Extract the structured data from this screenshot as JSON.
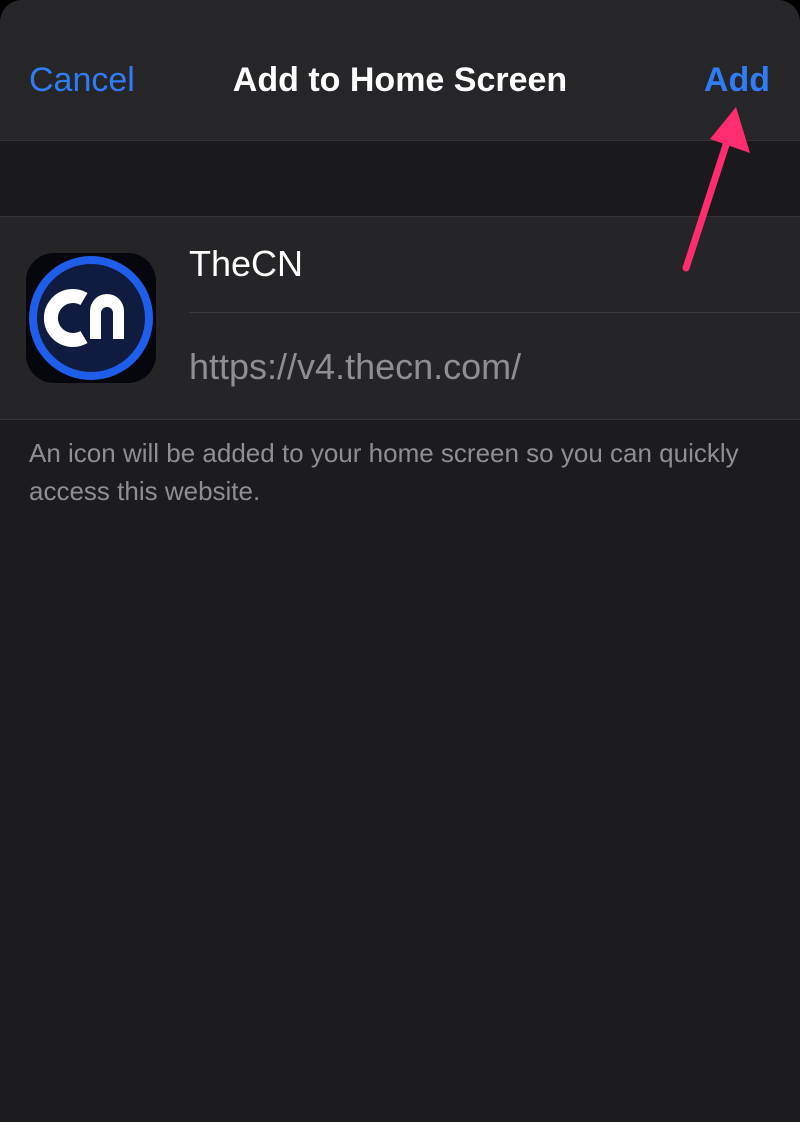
{
  "nav": {
    "cancel_label": "Cancel",
    "title": "Add to Home Screen",
    "add_label": "Add"
  },
  "app": {
    "name": "TheCN",
    "url": "https://v4.thecn.com/",
    "icon": "thecn-logo-icon"
  },
  "footnote": "An icon will be added to your home screen so you can quickly access this website.",
  "colors": {
    "accent": "#2f7cf6",
    "annotation": "#ff2d6f",
    "background": "#1c1c1e",
    "secondary_text": "#8e8e93"
  }
}
